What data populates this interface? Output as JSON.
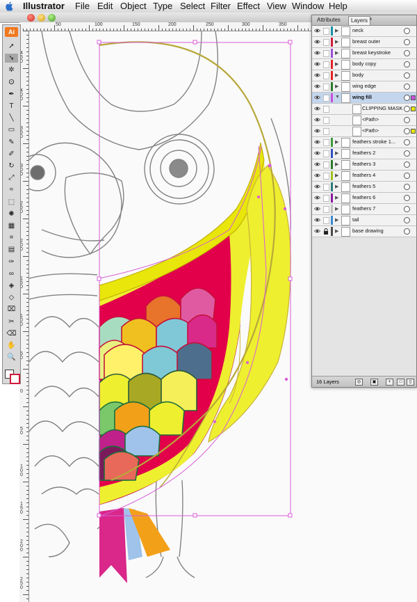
{
  "menubar": {
    "apple_icon": "apple-icon",
    "app": "Illustrator",
    "items": [
      "File",
      "Edit",
      "Object",
      "Type",
      "Select",
      "Filter",
      "Effect",
      "View",
      "Window",
      "Help"
    ]
  },
  "ruler": {
    "horizontal": [
      "50",
      "100",
      "150",
      "200",
      "250",
      "300",
      "350"
    ],
    "vertical": [
      "450",
      "400",
      "350",
      "300",
      "250",
      "200",
      "150",
      "100",
      "50",
      "0",
      "50",
      "100",
      "150",
      "200",
      "250"
    ]
  },
  "tools": {
    "logo": "Ai",
    "items": [
      "selection-tool",
      "direct-selection-tool",
      "magic-wand-tool",
      "lasso-tool",
      "pen-tool",
      "type-tool",
      "line-tool",
      "rectangle-tool",
      "paintbrush-tool",
      "pencil-tool",
      "rotate-tool",
      "scale-tool",
      "warp-tool",
      "free-transform-tool",
      "symbol-sprayer-tool",
      "graph-tool",
      "mesh-tool",
      "gradient-tool",
      "eyedropper-tool",
      "blend-tool",
      "live-paint-tool",
      "live-paint-selection-tool",
      "crop-tool",
      "slice-tool",
      "eraser-tool",
      "hand-tool",
      "zoom-tool"
    ]
  },
  "layers_panel": {
    "tabs": [
      "Attributes",
      "Layers"
    ],
    "active_tab": "Layers",
    "rows": [
      {
        "name": "neck",
        "color": "#1a8fa5",
        "expanded": false,
        "selected": false,
        "locked": false
      },
      {
        "name": "breast outer",
        "color": "#d01a3a",
        "expanded": false,
        "selected": false,
        "locked": false
      },
      {
        "name": "breast keystroke",
        "color": "#9b4dd6",
        "expanded": false,
        "selected": false,
        "locked": false
      },
      {
        "name": "body copy",
        "color": "#e52222",
        "expanded": false,
        "selected": false,
        "locked": false
      },
      {
        "name": "body",
        "color": "#e52222",
        "expanded": false,
        "selected": false,
        "locked": false
      },
      {
        "name": "wing edge",
        "color": "#2a7a2a",
        "expanded": false,
        "selected": false,
        "locked": false
      },
      {
        "name": "wing fill",
        "color": "#c84fd8",
        "expanded": true,
        "selected": true,
        "locked": false
      },
      {
        "name": "CLIPPING MASK",
        "color": "#f2f2f2",
        "expanded": false,
        "selected": false,
        "locked": false,
        "sublayer": true
      },
      {
        "name": "<Path>",
        "color": "#f2f2f2",
        "expanded": false,
        "selected": false,
        "locked": false,
        "sublayer": true
      },
      {
        "name": "<Path>",
        "color": "#f2f2f2",
        "expanded": false,
        "selected": false,
        "locked": false,
        "sublayer": true
      },
      {
        "name": "feathers stroke 1...",
        "color": "#3a9a3a",
        "expanded": false,
        "selected": false,
        "locked": false
      },
      {
        "name": "feathers 2",
        "color": "#3050c0",
        "expanded": false,
        "selected": false,
        "locked": false
      },
      {
        "name": "feathers 3",
        "color": "#2a7a2a",
        "expanded": false,
        "selected": false,
        "locked": false
      },
      {
        "name": "feathers 4",
        "color": "#a0c020",
        "expanded": false,
        "selected": false,
        "locked": false
      },
      {
        "name": "feathers 5",
        "color": "#2a7a7a",
        "expanded": false,
        "selected": false,
        "locked": false
      },
      {
        "name": "feathers 6",
        "color": "#8a1aa0",
        "expanded": false,
        "selected": false,
        "locked": false
      },
      {
        "name": "feathers 7",
        "color": "#c0c0c0",
        "expanded": false,
        "selected": false,
        "locked": false
      },
      {
        "name": "tail",
        "color": "#3a8ad0",
        "expanded": false,
        "selected": false,
        "locked": false
      },
      {
        "name": "base drawing",
        "color": "#4a4a4a",
        "expanded": false,
        "selected": false,
        "locked": true
      }
    ],
    "footer_count": "16 Layers"
  },
  "colors": {
    "selection": "#d85cd8",
    "wing_yellow": "#eeef2f",
    "wing_magenta": "#e2004a",
    "tail_pink": "#d9278a",
    "tail_orange": "#f3a019",
    "tail_blue": "#9fc3ea"
  }
}
